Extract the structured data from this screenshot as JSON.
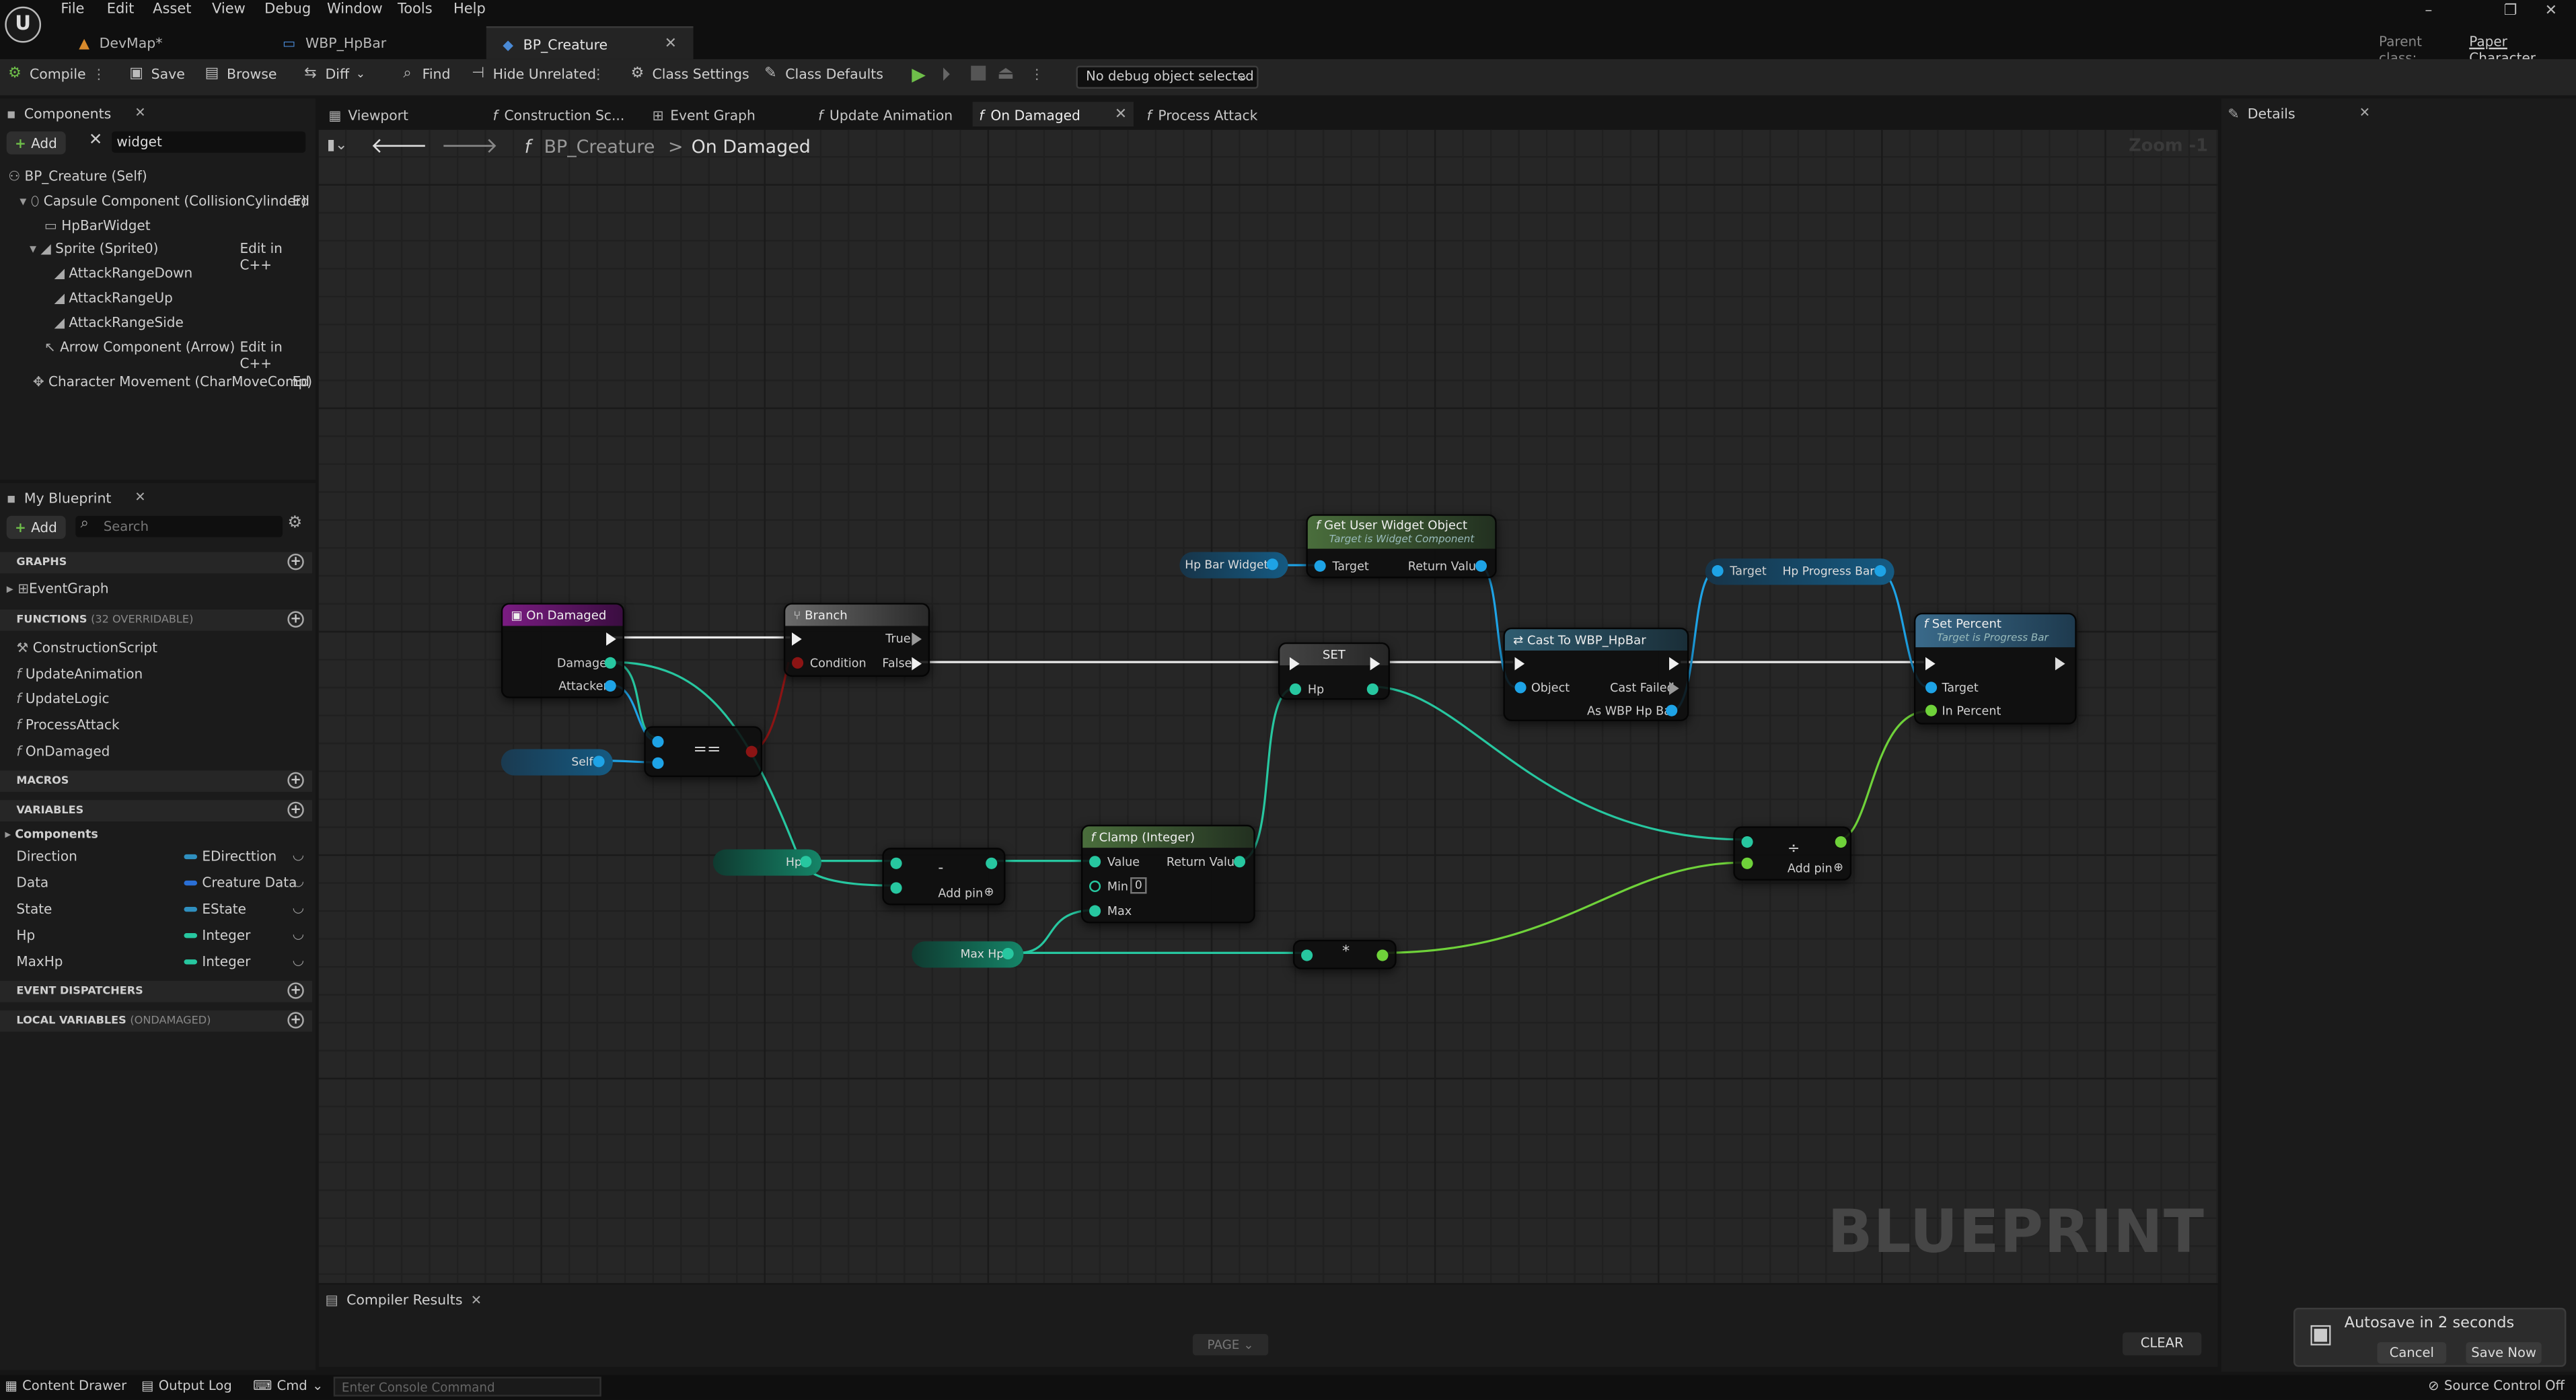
{
  "menubar": {
    "items": [
      "File",
      "Edit",
      "Asset",
      "View",
      "Debug",
      "Window",
      "Tools",
      "Help"
    ]
  },
  "doc_tabs": [
    "DevMap*",
    "WBP_HpBar",
    "BP_Creature"
  ],
  "parent_class": {
    "label": "Parent class:",
    "value": "Paper Character"
  },
  "toolbar": {
    "compile": "Compile",
    "save": "Save",
    "browse": "Browse",
    "diff": "Diff",
    "find": "Find",
    "hide_unrelated": "Hide Unrelated",
    "class_settings": "Class Settings",
    "class_defaults": "Class Defaults",
    "debug_object": "No debug object selected"
  },
  "components_panel": {
    "title": "Components",
    "add": "Add",
    "search_value": "widget",
    "items": [
      "BP_Creature (Self)",
      "Capsule Component (CollisionCylinder)",
      "HpBarWidget",
      "Sprite (Sprite0)",
      "AttackRangeDown",
      "AttackRangeUp",
      "AttackRangeSide",
      "Arrow Component (Arrow)",
      "Character Movement (CharMoveComp)"
    ],
    "edit_cpp": "Edit in C++",
    "edit_short": "Ed"
  },
  "my_blueprint": {
    "title": "My Blueprint",
    "add": "Add",
    "search_placeholder": "Search",
    "graphs_label": "GRAPHS",
    "graphs": [
      "EventGraph"
    ],
    "functions_label": "FUNCTIONS",
    "functions_count": "(32 OVERRIDABLE)",
    "functions": [
      "ConstructionScript",
      "UpdateAnimation",
      "UpdateLogic",
      "ProcessAttack",
      "OnDamaged"
    ],
    "macros_label": "MACROS",
    "variables_label": "VARIABLES",
    "components_label": "Components",
    "variables": [
      {
        "name": "Direction",
        "type": "EDirecttion",
        "color": "#2f8fbf"
      },
      {
        "name": "Data",
        "type": "Creature Data",
        "color": "#2a6fd6"
      },
      {
        "name": "State",
        "type": "EState",
        "color": "#2f8fbf"
      },
      {
        "name": "Hp",
        "type": "Integer",
        "color": "#27c7a0"
      },
      {
        "name": "MaxHp",
        "type": "Integer",
        "color": "#27c7a0"
      }
    ],
    "event_dispatchers_label": "EVENT DISPATCHERS",
    "local_variables_label": "LOCAL VARIABLES",
    "local_variables_scope": "(ONDAMAGED)"
  },
  "graph_tabs": [
    "Viewport",
    "Construction Sc...",
    "Event Graph",
    "Update Animation",
    "On Damaged",
    "Process Attack"
  ],
  "breadcrumb": {
    "root": "BP_Creature",
    "sep": ">",
    "current": "On Damaged"
  },
  "zoom": "Zoom -1",
  "watermark": "BLUEPRINT",
  "nodes": {
    "on_damaged": {
      "title": "On Damaged",
      "damage": "Damage",
      "attacker": "Attacker"
    },
    "branch": {
      "title": "Branch",
      "condition": "Condition",
      "true": "True",
      "false": "False"
    },
    "equal": {
      "op": "=="
    },
    "self": {
      "label": "Self"
    },
    "hp_get": {
      "label": "Hp"
    },
    "subtract": {
      "op": "-",
      "add_pin": "Add pin"
    },
    "clamp": {
      "title": "Clamp (Integer)",
      "value": "Value",
      "min": "Min",
      "min_value": "0",
      "max": "Max",
      "return_value": "Return Value"
    },
    "max_hp": {
      "label": "Max Hp"
    },
    "multiply": {
      "op": "*"
    },
    "get_widget_obj": {
      "title": "Get User Widget Object",
      "subtitle": "Target is Widget Component",
      "target": "Target",
      "return_value": "Return Value"
    },
    "hp_bar_widget": {
      "label": "Hp Bar Widget"
    },
    "set_hp": {
      "title": "SET",
      "hp": "Hp"
    },
    "cast": {
      "title": "Cast To WBP_HpBar",
      "object": "Object",
      "cast_failed": "Cast Failed",
      "as": "As WBP Hp Bar"
    },
    "progress_bar": {
      "target": "Target",
      "label": "Hp Progress Bar"
    },
    "divide": {
      "op": "÷",
      "add_pin": "Add pin"
    },
    "set_percent": {
      "title": "Set Percent",
      "subtitle": "Target is Progress Bar",
      "target": "Target",
      "in_percent": "In Percent"
    }
  },
  "details_panel": {
    "title": "Details"
  },
  "compiler": {
    "title": "Compiler Results",
    "page": "PAGE",
    "clear": "CLEAR"
  },
  "statusbar": {
    "content_drawer": "Content Drawer",
    "output_log": "Output Log",
    "cmd": "Cmd",
    "console_placeholder": "Enter Console Command",
    "source_control": "Source Control Off"
  },
  "autosave": {
    "message": "Autosave in 2 seconds",
    "cancel": "Cancel",
    "save_now": "Save Now"
  },
  "colors": {
    "exec": "#f0f0f0",
    "integer": "#27c7a0",
    "object": "#1ea3e6",
    "bool": "#8c1414",
    "float": "#6fd23a",
    "function_header": "#3a5a7a",
    "event_header": "#7a1c82"
  }
}
